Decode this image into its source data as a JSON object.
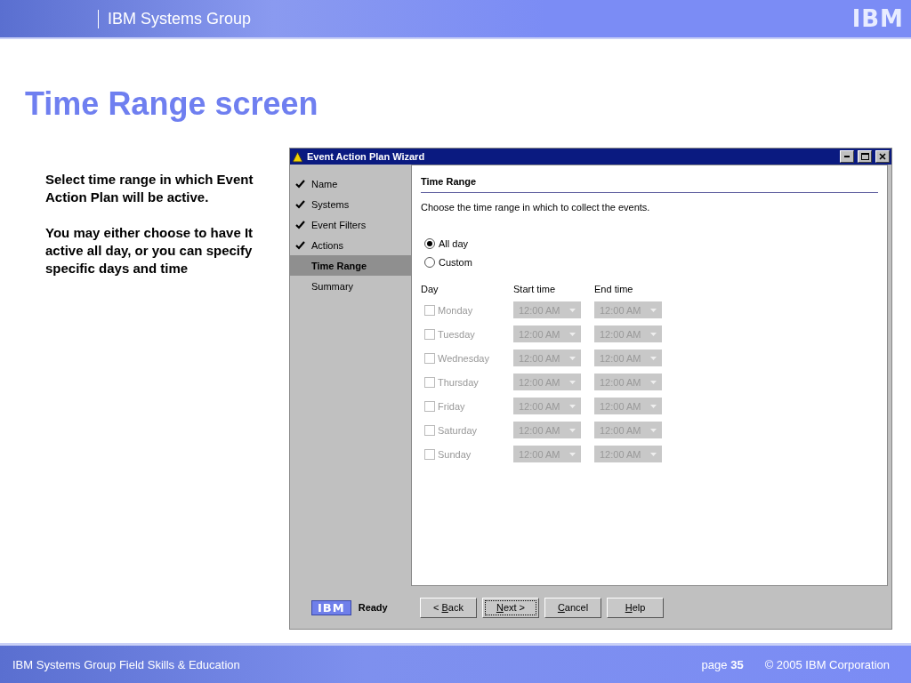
{
  "header": {
    "title": "IBM Systems Group",
    "logo": "IBM"
  },
  "slide_title": "Time Range screen",
  "description": [
    "Select time range in which Event Action Plan will be active.",
    "You may either choose to have It active all day, or you can specify specific days and time"
  ],
  "window": {
    "title": "Event Action Plan Wizard",
    "steps": [
      {
        "label": "Name",
        "done": true,
        "selected": false
      },
      {
        "label": "Systems",
        "done": true,
        "selected": false
      },
      {
        "label": "Event Filters",
        "done": true,
        "selected": false
      },
      {
        "label": "Actions",
        "done": true,
        "selected": false
      },
      {
        "label": "Time Range",
        "done": false,
        "selected": true
      },
      {
        "label": "Summary",
        "done": false,
        "selected": false
      }
    ],
    "section_title": "Time Range",
    "instruction": "Choose the time range in which to collect the events.",
    "options": [
      {
        "label": "All day",
        "selected": true
      },
      {
        "label": "Custom",
        "selected": false
      }
    ],
    "columns": [
      "Day",
      "Start time",
      "End time"
    ],
    "days": [
      {
        "label": "Monday",
        "checked": false,
        "disabled": true,
        "start": "12:00 AM",
        "end": "12:00 AM"
      },
      {
        "label": "Tuesday",
        "checked": false,
        "disabled": true,
        "start": "12:00 AM",
        "end": "12:00 AM"
      },
      {
        "label": "Wednesday",
        "checked": false,
        "disabled": true,
        "start": "12:00 AM",
        "end": "12:00 AM"
      },
      {
        "label": "Thursday",
        "checked": false,
        "disabled": true,
        "start": "12:00 AM",
        "end": "12:00 AM"
      },
      {
        "label": "Friday",
        "checked": false,
        "disabled": true,
        "start": "12:00 AM",
        "end": "12:00 AM"
      },
      {
        "label": "Saturday",
        "checked": false,
        "disabled": true,
        "start": "12:00 AM",
        "end": "12:00 AM"
      },
      {
        "label": "Sunday",
        "checked": false,
        "disabled": true,
        "start": "12:00 AM",
        "end": "12:00 AM"
      }
    ],
    "status_logo": "IBM",
    "status": "Ready",
    "buttons": [
      {
        "before": "< ",
        "key": "B",
        "after": "ack",
        "focused": false
      },
      {
        "key": "N",
        "after": "ext >",
        "focused": true
      },
      {
        "key": "C",
        "after": "ancel",
        "focused": false
      },
      {
        "key": "H",
        "after": "elp",
        "focused": false
      }
    ]
  },
  "footer": {
    "left": "IBM Systems Group Field Skills & Education",
    "page": "page **35**",
    "copyright": "© 2005 IBM Corporation"
  }
}
